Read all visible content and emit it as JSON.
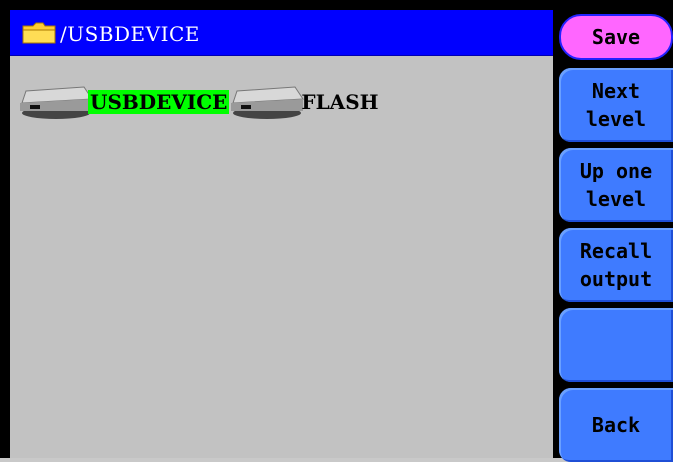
{
  "path_bar": {
    "path": "/USBDEVICE",
    "folder_icon": "folder-icon"
  },
  "devices": [
    {
      "label": "USBDEVICE",
      "icon": "drive-icon",
      "selected": true
    },
    {
      "label": "FLASH",
      "icon": "drive-icon",
      "selected": false
    }
  ],
  "side_menu": {
    "save": "Save",
    "next_level": "Next\nlevel",
    "up_one_level": "Up one\nlevel",
    "recall_output": "Recall\noutput",
    "empty": "",
    "back": "Back"
  },
  "colors": {
    "path_bar": "#0000ff",
    "selected_highlight": "#00ff00",
    "save_button": "#ff66ff",
    "menu_button": "#3f7bff"
  }
}
